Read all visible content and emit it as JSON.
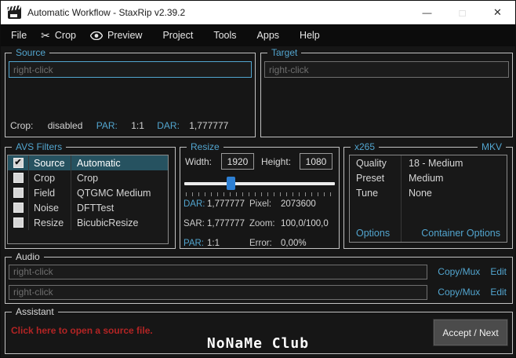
{
  "window": {
    "title": "Automatic Workflow - StaxRip v2.39.2"
  },
  "titlebar_icons": {
    "minimize": "—",
    "maximize": "□",
    "close": "✕"
  },
  "menu": {
    "items": [
      {
        "label": "File"
      },
      {
        "label": "Crop",
        "icon": "scissors"
      },
      {
        "label": "Preview",
        "icon": "eye"
      },
      {
        "label": "Project"
      },
      {
        "label": "Tools"
      },
      {
        "label": "Apps"
      },
      {
        "label": "Help"
      }
    ],
    "scissors_glyph": "✂"
  },
  "source": {
    "caption": "Source",
    "placeholder": "right-click",
    "stats": [
      {
        "label": "Crop:",
        "value": "disabled"
      },
      {
        "label": "PAR:",
        "value": "1:1"
      },
      {
        "label": "DAR:",
        "value": "1,777777"
      }
    ]
  },
  "target": {
    "caption": "Target",
    "placeholder": "right-click"
  },
  "avs_filters": {
    "caption": "AVS Filters",
    "rows": [
      {
        "check": "✔",
        "type": "Source",
        "name": "Automatic",
        "selected": true
      },
      {
        "check": "",
        "type": "Crop",
        "name": "Crop"
      },
      {
        "check": "",
        "type": "Field",
        "name": "QTGMC Medium"
      },
      {
        "check": "",
        "type": "Noise",
        "name": "DFTTest"
      },
      {
        "check": "",
        "type": "Resize",
        "name": "BicubicResize"
      }
    ]
  },
  "resize": {
    "caption": "Resize",
    "width_label": "Width:",
    "width_value": "1920",
    "height_label": "Height:",
    "height_value": "1080",
    "slider_percent": 31,
    "stats": [
      [
        "DAR:",
        "1,777777",
        "Pixel:",
        "2073600"
      ],
      [
        "SAR:",
        "1,777777",
        "Zoom:",
        "100,0/100,0"
      ],
      [
        "PAR:",
        "1:1",
        "Error:",
        "0,00%"
      ]
    ]
  },
  "x265": {
    "caption": "x265",
    "container": "MKV",
    "rows": [
      {
        "label": "Quality",
        "value": "18 - Medium"
      },
      {
        "label": "Preset",
        "value": "Medium"
      },
      {
        "label": "Tune",
        "value": "None"
      }
    ],
    "options_link": "Options",
    "container_options_link": "Container Options"
  },
  "audio": {
    "caption": "Audio",
    "tracks": [
      {
        "placeholder": "right-click",
        "copy_mux": "Copy/Mux",
        "edit": "Edit"
      },
      {
        "placeholder": "right-click",
        "copy_mux": "Copy/Mux",
        "edit": "Edit"
      }
    ]
  },
  "assistant": {
    "caption": "Assistant",
    "message": "Click here to open a source file.",
    "accept_button": "Accept / Next"
  },
  "watermark": "NoNaMe Club",
  "colors": {
    "accent_teal": "#52a5cf",
    "titlebar_bg": "#ffffff",
    "menubar_bg": "#0c0c0c",
    "window_bg": "#161616",
    "selected_row_bg": "#265260",
    "slider_thumb_blue": "#2d7fd3",
    "assistant_message_red": "#b32424",
    "group_border": "#c2c2c2",
    "button_bg": "#4b4b4b"
  }
}
